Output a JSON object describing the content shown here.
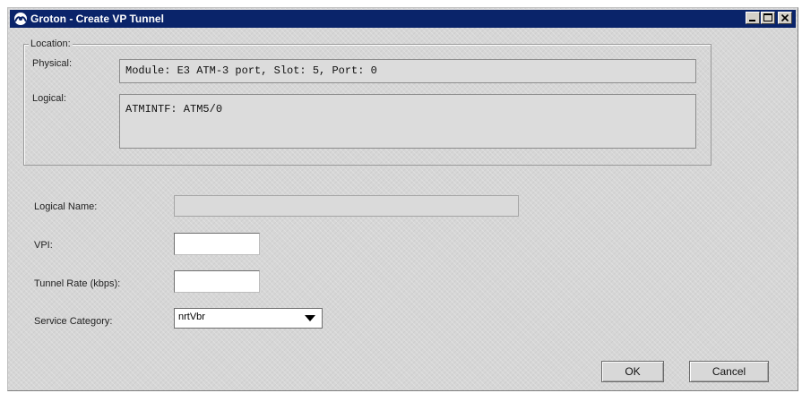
{
  "window": {
    "title": "Groton - Create VP Tunnel",
    "icon": "network-icon",
    "controls": {
      "minimize": "minimize-icon",
      "maximize": "maximize-icon",
      "close": "close-icon"
    }
  },
  "location": {
    "legend": "Location:",
    "physical_label": "Physical:",
    "physical_value": "Module: E3 ATM-3 port, Slot: 5, Port: 0",
    "logical_label": "Logical:",
    "logical_value": "ATMINTF: ATM5/0"
  },
  "form": {
    "logical_name_label": "Logical Name:",
    "logical_name_value": "",
    "vpi_label": "VPI:",
    "vpi_value": "",
    "tunnel_rate_label": "Tunnel Rate (kbps):",
    "tunnel_rate_value": "",
    "service_category_label": "Service Category:",
    "service_category_value": "nrtVbr"
  },
  "buttons": {
    "ok": "OK",
    "cancel": "Cancel"
  }
}
